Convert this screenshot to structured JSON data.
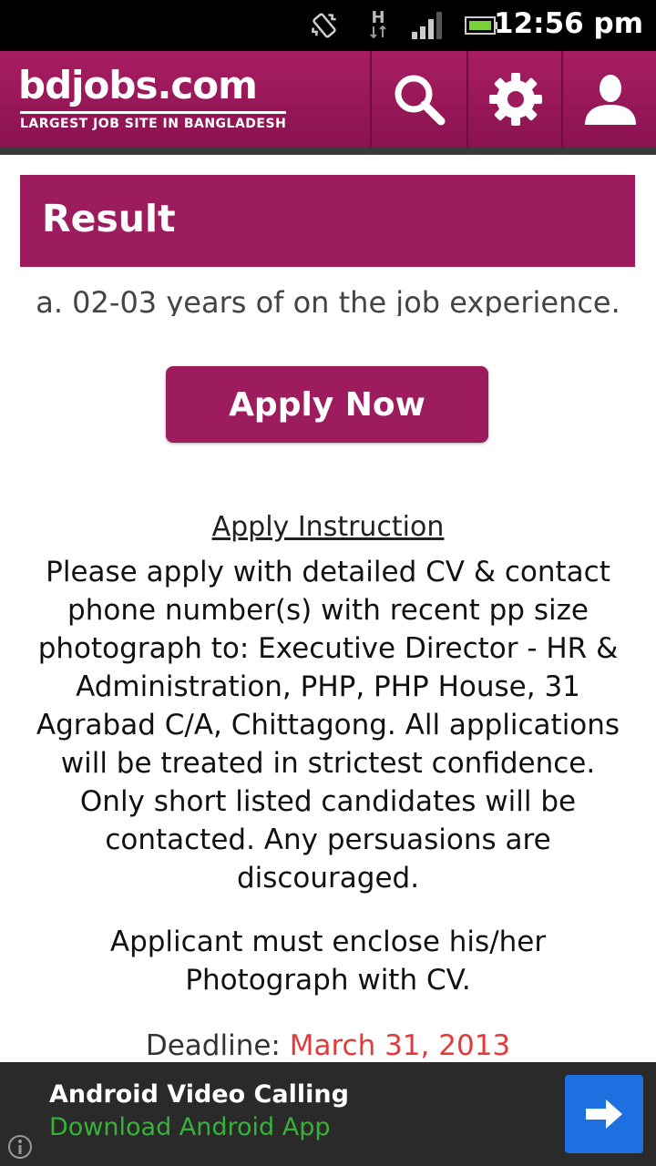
{
  "status_bar": {
    "time": "12:56 pm",
    "network_letter": "H",
    "icons": [
      "vibrate-icon",
      "network-h-icon",
      "signal-icon",
      "battery-icon"
    ]
  },
  "header": {
    "logo_text": "bdjobs.com",
    "tagline": "LARGEST JOB SITE IN BANGLADESH",
    "actions": [
      "search-icon",
      "settings-gear-icon",
      "user-profile-icon"
    ],
    "bg_color": "#9c1c5e"
  },
  "result": {
    "title": "Result"
  },
  "job": {
    "experience_line": "a. 02-03 years of on the job experience.",
    "apply_button": "Apply Now",
    "instruction_heading": "Apply Instruction",
    "instruction_text": "Please apply with detailed CV & contact phone number(s) with recent pp size photograph to: Executive Director - HR & Administration, PHP, PHP House, 31 Agrabad C/A, Chittagong. All applications will be treated in strictest confidence. Only short listed candidates will be contacted. Any persuasions are discouraged.",
    "enclose_text": "Applicant must enclose his/her Photograph with CV.",
    "deadline_label": "Deadline:",
    "deadline_date": "March 31, 2013",
    "deadline_color": "#e23b3b"
  },
  "ad": {
    "title": "Android Video Calling",
    "subtitle": "Download Android App",
    "button_icon": "arrow-right-icon",
    "info_icon": "info-icon"
  }
}
